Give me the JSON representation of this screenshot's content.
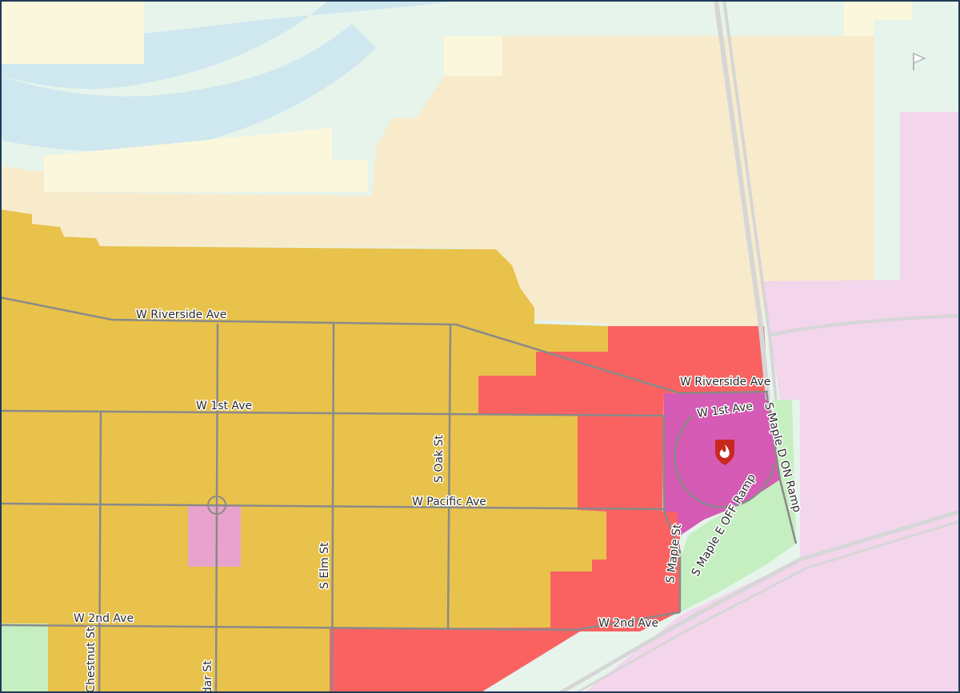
{
  "map": {
    "colors": {
      "water": "#cfe7ef",
      "open_space": "#e6f4ec",
      "light_beige": "#fbf7dc",
      "tan": "#f8ebcc",
      "gold": "#e8c24a",
      "red": "#fa6262",
      "magenta": "#d65bb5",
      "pink": "#f3d5ec",
      "light_pink": "#e8a3cc",
      "green": "#c5efc0",
      "road": "#8a8a8a",
      "highway": "#d6d6d6",
      "marker_red": "#c8281e"
    },
    "streets": {
      "w_riverside_ave_west": "W Riverside Ave",
      "w_riverside_ave_east": "W Riverside Ave",
      "w_1st_ave_west": "W 1st Ave",
      "w_1st_ave_east": "W 1st Ave",
      "w_pacific_ave": "W Pacific Ave",
      "w_2nd_ave_west": "W 2nd Ave",
      "w_2nd_ave_east": "W 2nd Ave",
      "s_oak_st": "S Oak St",
      "s_elm_st": "S Elm St",
      "s_chestnut_st": "S Chestnut St",
      "s_cedar_st": "S Cedar St",
      "s_maple_st": "S Maple St",
      "s_maple_d_on_ramp": "S Maple D ON Ramp",
      "s_maple_e_off_ramp": "S Maple E OFF Ramp"
    },
    "markers": {
      "fire_station": "fire-station-icon",
      "flag": "flag-icon"
    }
  }
}
